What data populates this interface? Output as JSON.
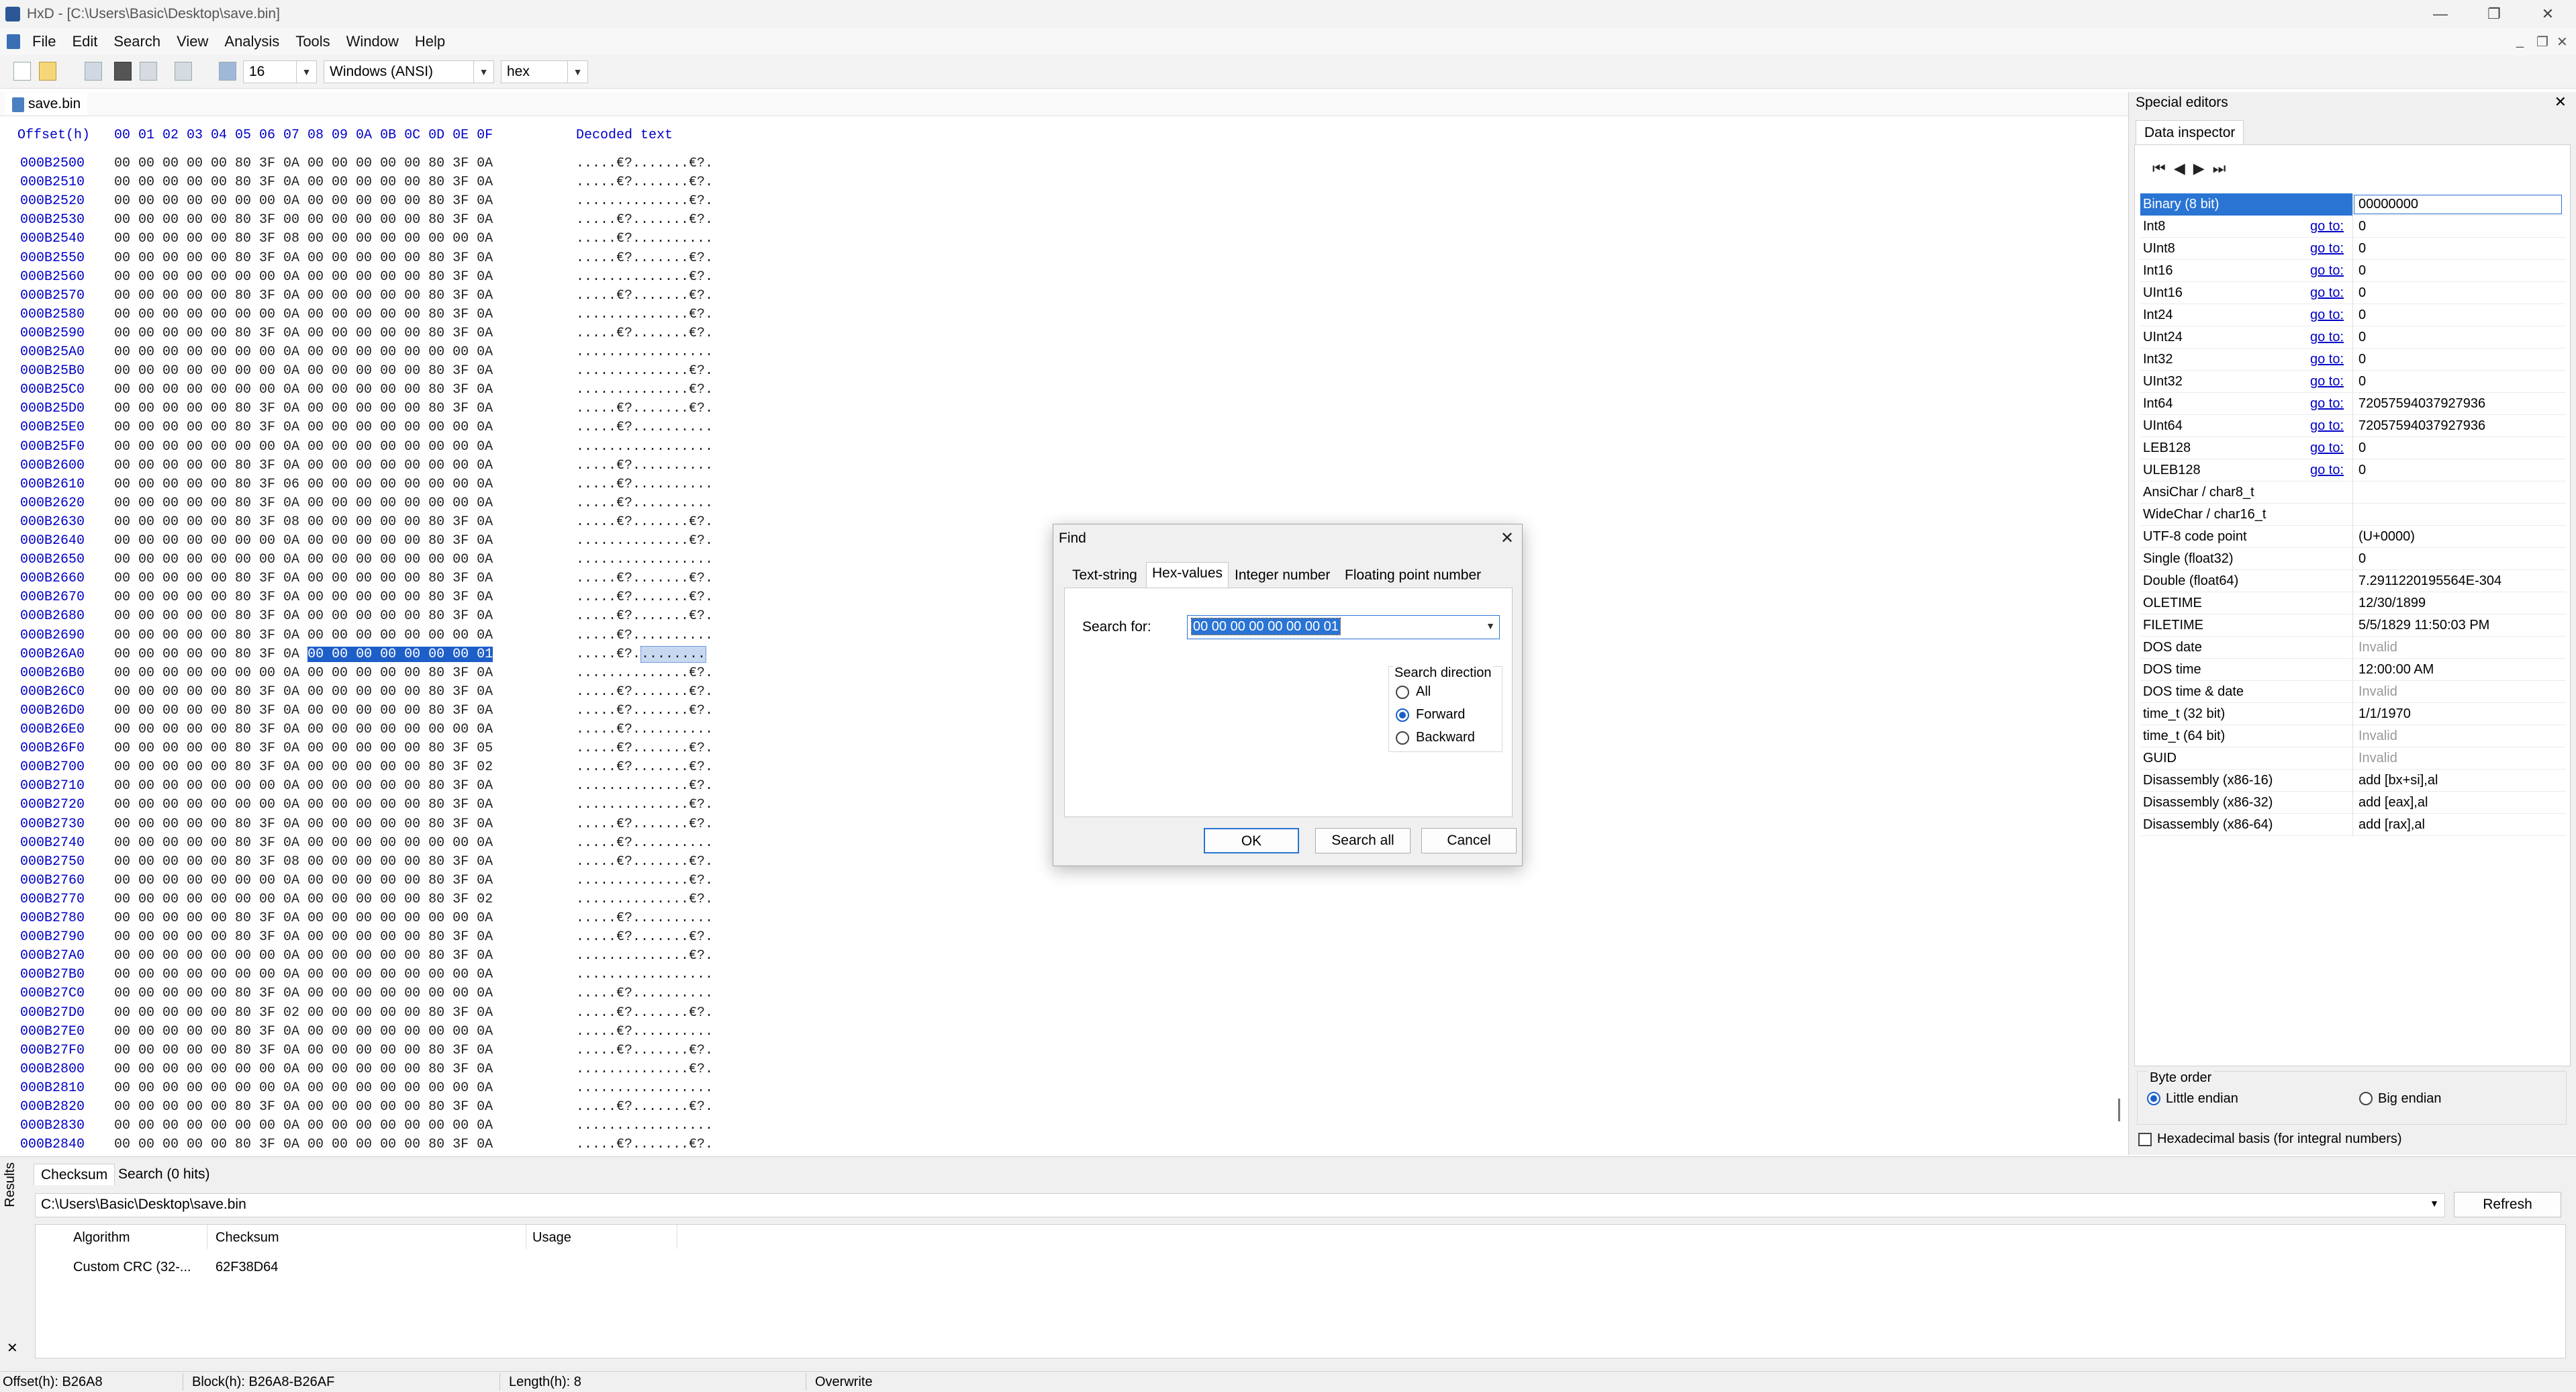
{
  "window": {
    "title": "HxD - [C:\\Users\\Basic\\Desktop\\save.bin]",
    "controls": [
      "—",
      "❐",
      "✕"
    ]
  },
  "menu": {
    "items": [
      "File",
      "Edit",
      "Search",
      "View",
      "Analysis",
      "Tools",
      "Window",
      "Help"
    ],
    "mdi_controls": [
      "_",
      "❐",
      "✕"
    ]
  },
  "toolbar": {
    "bytes_per_row": "16",
    "charset": "Windows (ANSI)",
    "display_mode": "hex"
  },
  "document_tab": {
    "name": "save.bin"
  },
  "hex_view": {
    "header_offset": "Offset(h)",
    "header_columns": "00 01 02 03 04 05 06 07 08 09 0A 0B 0C 0D 0E 0F",
    "header_text": "Decoded text",
    "rows": [
      {
        "offset": "000B2500",
        "hex": "00 00 00 00 00 80 3F 0A 00 00 00 00 00 80 3F 0A",
        "text": ".....€?.......€?."
      },
      {
        "offset": "000B2510",
        "hex": "00 00 00 00 00 80 3F 0A 00 00 00 00 00 80 3F 0A",
        "text": ".....€?.......€?."
      },
      {
        "offset": "000B2520",
        "hex": "00 00 00 00 00 00 00 0A 00 00 00 00 00 80 3F 0A",
        "text": "..............€?."
      },
      {
        "offset": "000B2530",
        "hex": "00 00 00 00 00 80 3F 00 00 00 00 00 00 80 3F 0A",
        "text": ".....€?.......€?."
      },
      {
        "offset": "000B2540",
        "hex": "00 00 00 00 00 80 3F 08 00 00 00 00 00 00 00 0A",
        "text": ".....€?.........."
      },
      {
        "offset": "000B2550",
        "hex": "00 00 00 00 00 80 3F 0A 00 00 00 00 00 80 3F 0A",
        "text": ".....€?.......€?."
      },
      {
        "offset": "000B2560",
        "hex": "00 00 00 00 00 00 00 0A 00 00 00 00 00 80 3F 0A",
        "text": "..............€?."
      },
      {
        "offset": "000B2570",
        "hex": "00 00 00 00 00 80 3F 0A 00 00 00 00 00 80 3F 0A",
        "text": ".....€?.......€?."
      },
      {
        "offset": "000B2580",
        "hex": "00 00 00 00 00 00 00 0A 00 00 00 00 00 80 3F 0A",
        "text": "..............€?."
      },
      {
        "offset": "000B2590",
        "hex": "00 00 00 00 00 80 3F 0A 00 00 00 00 00 80 3F 0A",
        "text": ".....€?.......€?."
      },
      {
        "offset": "000B25A0",
        "hex": "00 00 00 00 00 00 00 0A 00 00 00 00 00 00 00 0A",
        "text": "................."
      },
      {
        "offset": "000B25B0",
        "hex": "00 00 00 00 00 00 00 0A 00 00 00 00 00 80 3F 0A",
        "text": "..............€?."
      },
      {
        "offset": "000B25C0",
        "hex": "00 00 00 00 00 00 00 0A 00 00 00 00 00 80 3F 0A",
        "text": "..............€?."
      },
      {
        "offset": "000B25D0",
        "hex": "00 00 00 00 00 80 3F 0A 00 00 00 00 00 80 3F 0A",
        "text": ".....€?.......€?."
      },
      {
        "offset": "000B25E0",
        "hex": "00 00 00 00 00 80 3F 0A 00 00 00 00 00 00 00 0A",
        "text": ".....€?.........."
      },
      {
        "offset": "000B25F0",
        "hex": "00 00 00 00 00 00 00 0A 00 00 00 00 00 00 00 0A",
        "text": "................."
      },
      {
        "offset": "000B2600",
        "hex": "00 00 00 00 00 80 3F 0A 00 00 00 00 00 00 00 0A",
        "text": ".....€?.........."
      },
      {
        "offset": "000B2610",
        "hex": "00 00 00 00 00 80 3F 06 00 00 00 00 00 00 00 0A",
        "text": ".....€?.........."
      },
      {
        "offset": "000B2620",
        "hex": "00 00 00 00 00 80 3F 0A 00 00 00 00 00 00 00 0A",
        "text": ".....€?.........."
      },
      {
        "offset": "000B2630",
        "hex": "00 00 00 00 00 80 3F 08 00 00 00 00 00 80 3F 0A",
        "text": ".....€?.......€?."
      },
      {
        "offset": "000B2640",
        "hex": "00 00 00 00 00 00 00 0A 00 00 00 00 00 80 3F 0A",
        "text": "..............€?."
      },
      {
        "offset": "000B2650",
        "hex": "00 00 00 00 00 00 00 0A 00 00 00 00 00 00 00 0A",
        "text": "................."
      },
      {
        "offset": "000B2660",
        "hex": "00 00 00 00 00 80 3F 0A 00 00 00 00 00 80 3F 0A",
        "text": ".....€?.......€?."
      },
      {
        "offset": "000B2670",
        "hex": "00 00 00 00 00 80 3F 0A 00 00 00 00 00 80 3F 0A",
        "text": ".....€?.......€?."
      },
      {
        "offset": "000B2680",
        "hex": "00 00 00 00 00 80 3F 0A 00 00 00 00 00 80 3F 0A",
        "text": ".....€?.......€?."
      },
      {
        "offset": "000B2690",
        "hex": "00 00 00 00 00 80 3F 0A 00 00 00 00 00 00 00 0A",
        "text": ".....€?.........."
      },
      {
        "offset": "000B26A0",
        "hex": "00 00 00 00 00 80 3F 0A",
        "hex_sel": "00 00 00 00 00 00 00 01",
        "text": ".....€?.",
        "text_sel": "........"
      },
      {
        "offset": "000B26B0",
        "hex": "00 00 00 00 00 00 00 0A 00 00 00 00 00 80 3F 0A",
        "text": "..............€?."
      },
      {
        "offset": "000B26C0",
        "hex": "00 00 00 00 00 80 3F 0A 00 00 00 00 00 80 3F 0A",
        "text": ".....€?.......€?."
      },
      {
        "offset": "000B26D0",
        "hex": "00 00 00 00 00 80 3F 0A 00 00 00 00 00 80 3F 0A",
        "text": ".....€?.......€?."
      },
      {
        "offset": "000B26E0",
        "hex": "00 00 00 00 00 80 3F 0A 00 00 00 00 00 00 00 0A",
        "text": ".....€?.........."
      },
      {
        "offset": "000B26F0",
        "hex": "00 00 00 00 00 80 3F 0A 00 00 00 00 00 80 3F 05",
        "text": ".....€?.......€?."
      },
      {
        "offset": "000B2700",
        "hex": "00 00 00 00 00 80 3F 0A 00 00 00 00 00 80 3F 02",
        "text": ".....€?.......€?."
      },
      {
        "offset": "000B2710",
        "hex": "00 00 00 00 00 00 00 0A 00 00 00 00 00 80 3F 0A",
        "text": "..............€?."
      },
      {
        "offset": "000B2720",
        "hex": "00 00 00 00 00 00 00 0A 00 00 00 00 00 80 3F 0A",
        "text": "..............€?."
      },
      {
        "offset": "000B2730",
        "hex": "00 00 00 00 00 80 3F 0A 00 00 00 00 00 80 3F 0A",
        "text": ".....€?.......€?."
      },
      {
        "offset": "000B2740",
        "hex": "00 00 00 00 00 80 3F 0A 00 00 00 00 00 00 00 0A",
        "text": ".....€?.........."
      },
      {
        "offset": "000B2750",
        "hex": "00 00 00 00 00 80 3F 08 00 00 00 00 00 80 3F 0A",
        "text": ".....€?.......€?."
      },
      {
        "offset": "000B2760",
        "hex": "00 00 00 00 00 00 00 0A 00 00 00 00 00 80 3F 0A",
        "text": "..............€?."
      },
      {
        "offset": "000B2770",
        "hex": "00 00 00 00 00 00 00 0A 00 00 00 00 00 80 3F 02",
        "text": "..............€?."
      },
      {
        "offset": "000B2780",
        "hex": "00 00 00 00 00 80 3F 0A 00 00 00 00 00 00 00 0A",
        "text": ".....€?.........."
      },
      {
        "offset": "000B2790",
        "hex": "00 00 00 00 00 80 3F 0A 00 00 00 00 00 80 3F 0A",
        "text": ".....€?.......€?."
      },
      {
        "offset": "000B27A0",
        "hex": "00 00 00 00 00 00 00 0A 00 00 00 00 00 80 3F 0A",
        "text": "..............€?."
      },
      {
        "offset": "000B27B0",
        "hex": "00 00 00 00 00 00 00 0A 00 00 00 00 00 00 00 0A",
        "text": "................."
      },
      {
        "offset": "000B27C0",
        "hex": "00 00 00 00 00 80 3F 0A 00 00 00 00 00 00 00 0A",
        "text": ".....€?.........."
      },
      {
        "offset": "000B27D0",
        "hex": "00 00 00 00 00 80 3F 02 00 00 00 00 00 80 3F 0A",
        "text": ".....€?.......€?."
      },
      {
        "offset": "000B27E0",
        "hex": "00 00 00 00 00 80 3F 0A 00 00 00 00 00 00 00 0A",
        "text": ".....€?.........."
      },
      {
        "offset": "000B27F0",
        "hex": "00 00 00 00 00 80 3F 0A 00 00 00 00 00 80 3F 0A",
        "text": ".....€?.......€?."
      },
      {
        "offset": "000B2800",
        "hex": "00 00 00 00 00 00 00 0A 00 00 00 00 00 80 3F 0A",
        "text": "..............€?."
      },
      {
        "offset": "000B2810",
        "hex": "00 00 00 00 00 00 00 0A 00 00 00 00 00 00 00 0A",
        "text": "................."
      },
      {
        "offset": "000B2820",
        "hex": "00 00 00 00 00 80 3F 0A 00 00 00 00 00 80 3F 0A",
        "text": ".....€?.......€?."
      },
      {
        "offset": "000B2830",
        "hex": "00 00 00 00 00 00 00 0A 00 00 00 00 00 00 00 0A",
        "text": "................."
      },
      {
        "offset": "000B2840",
        "hex": "00 00 00 00 00 80 3F 0A 00 00 00 00 00 80 3F 0A",
        "text": ".....€?.......€?."
      }
    ]
  },
  "special_editors": {
    "title": "Special editors",
    "tab": "Data inspector",
    "nav_buttons": [
      "⏮",
      "◀",
      "▶",
      "⏭"
    ],
    "rows": [
      {
        "label": "Binary (8 bit)",
        "goto": "",
        "value": "00000000",
        "selected": true
      },
      {
        "label": "Int8",
        "goto": "go to:",
        "value": "0"
      },
      {
        "label": "UInt8",
        "goto": "go to:",
        "value": "0"
      },
      {
        "label": "Int16",
        "goto": "go to:",
        "value": "0"
      },
      {
        "label": "UInt16",
        "goto": "go to:",
        "value": "0"
      },
      {
        "label": "Int24",
        "goto": "go to:",
        "value": "0"
      },
      {
        "label": "UInt24",
        "goto": "go to:",
        "value": "0"
      },
      {
        "label": "Int32",
        "goto": "go to:",
        "value": "0"
      },
      {
        "label": "UInt32",
        "goto": "go to:",
        "value": "0"
      },
      {
        "label": "Int64",
        "goto": "go to:",
        "value": "72057594037927936"
      },
      {
        "label": "UInt64",
        "goto": "go to:",
        "value": "72057594037927936"
      },
      {
        "label": "LEB128",
        "goto": "go to:",
        "value": "0"
      },
      {
        "label": "ULEB128",
        "goto": "go to:",
        "value": "0"
      },
      {
        "label": "AnsiChar / char8_t",
        "goto": "",
        "value": ""
      },
      {
        "label": "WideChar / char16_t",
        "goto": "",
        "value": ""
      },
      {
        "label": "UTF-8 code point",
        "goto": "",
        "value": "  (U+0000)"
      },
      {
        "label": "Single (float32)",
        "goto": "",
        "value": "0"
      },
      {
        "label": "Double (float64)",
        "goto": "",
        "value": "7.2911220195564E-304"
      },
      {
        "label": "OLETIME",
        "goto": "",
        "value": "12/30/1899"
      },
      {
        "label": "FILETIME",
        "goto": "",
        "value": "5/5/1829 11:50:03 PM"
      },
      {
        "label": "DOS date",
        "goto": "",
        "value": "Invalid",
        "muted": true
      },
      {
        "label": "DOS time",
        "goto": "",
        "value": "12:00:00 AM"
      },
      {
        "label": "DOS time & date",
        "goto": "",
        "value": "Invalid",
        "muted": true
      },
      {
        "label": "time_t (32 bit)",
        "goto": "",
        "value": "1/1/1970"
      },
      {
        "label": "time_t (64 bit)",
        "goto": "",
        "value": "Invalid",
        "muted": true
      },
      {
        "label": "GUID",
        "goto": "",
        "value": "Invalid",
        "muted": true
      },
      {
        "label": "Disassembly (x86-16)",
        "goto": "",
        "value": "add [bx+si],al"
      },
      {
        "label": "Disassembly (x86-32)",
        "goto": "",
        "value": "add [eax],al"
      },
      {
        "label": "Disassembly (x86-64)",
        "goto": "",
        "value": "add [rax],al"
      }
    ],
    "byte_order": {
      "title": "Byte order",
      "little": "Little endian",
      "big": "Big endian",
      "selected": "little"
    },
    "hex_basis_label": "Hexadecimal basis (for integral numbers)"
  },
  "results": {
    "side_label": "Results",
    "tabs": [
      "Checksum",
      "Search (0 hits)"
    ],
    "path": "C:\\Users\\Basic\\Desktop\\save.bin",
    "refresh_label": "Refresh",
    "columns": [
      "Algorithm",
      "Checksum",
      "Usage"
    ],
    "rows": [
      {
        "algorithm": "Custom CRC (32-...",
        "checksum": "62F38D64",
        "usage": ""
      }
    ]
  },
  "status": {
    "offset": "Offset(h): B26A8",
    "block": "Block(h): B26A8-B26AF",
    "length": "Length(h): 8",
    "mode": "Overwrite"
  },
  "find_dialog": {
    "title": "Find",
    "tabs": [
      "Text-string",
      "Hex-values",
      "Integer number",
      "Floating point number"
    ],
    "active_tab": "Hex-values",
    "search_label": "Search for:",
    "search_value": "00 00 00 00 00 00 00 01",
    "direction_title": "Search direction",
    "directions": [
      "All",
      "Forward",
      "Backward"
    ],
    "selected_direction": "Forward",
    "ok_label": "OK",
    "search_all_label": "Search all",
    "cancel_label": "Cancel"
  },
  "colors": {
    "offset_blue": "#0000c8",
    "selection_blue": "#1e5ec8",
    "accent": "#2a74d4"
  }
}
